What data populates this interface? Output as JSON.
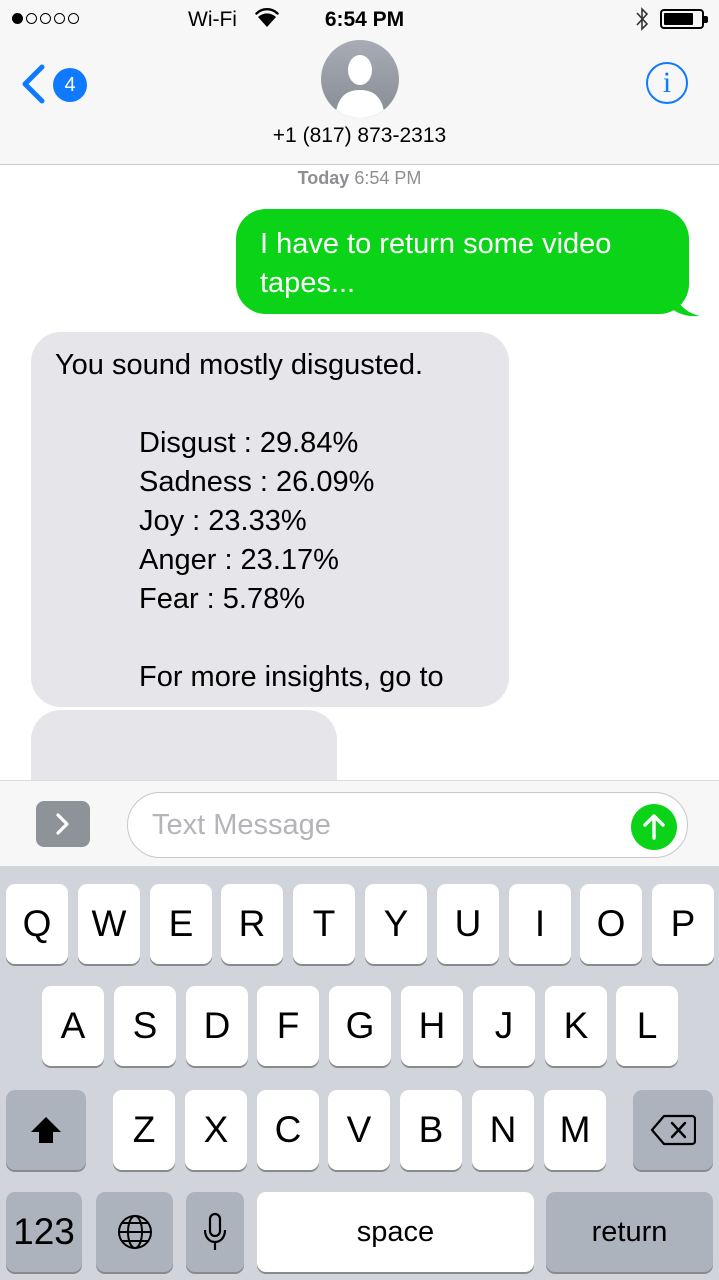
{
  "status_bar": {
    "carrier_signal": "●○○○○",
    "network": "Wi-Fi",
    "time": "6:54 PM",
    "wifi_icon": "wifi-icon",
    "bluetooth_icon": "bluetooth-icon",
    "battery_level": 0.8
  },
  "header": {
    "back_badge": "4",
    "contact": "+1 (817) 873-2313",
    "info_label": "i",
    "back_icon": "chevron-left-icon",
    "avatar_icon": "person-silhouette-icon"
  },
  "thread": {
    "timestamp_day": "Today",
    "timestamp_time": "6:54 PM",
    "messages": [
      {
        "direction": "sent",
        "text": "I have to return some video tapes..."
      },
      {
        "direction": "received",
        "intro": "You sound mostly disgusted.",
        "scores": [
          {
            "label": "Disgust : 29.84%"
          },
          {
            "label": "Sadness : 26.09%"
          },
          {
            "label": "Joy : 23.33%"
          },
          {
            "label": "Anger : 23.17%"
          },
          {
            "label": "Fear : 5.78%"
          }
        ],
        "footer": "For more insights, go to"
      }
    ]
  },
  "input": {
    "placeholder": "Text Message",
    "apps_icon": "chevron-right-icon",
    "send_icon": "arrow-up-icon"
  },
  "keyboard": {
    "row1": [
      "Q",
      "W",
      "E",
      "R",
      "T",
      "Y",
      "U",
      "I",
      "O",
      "P"
    ],
    "row2": [
      "A",
      "S",
      "D",
      "F",
      "G",
      "H",
      "J",
      "K",
      "L"
    ],
    "row3": [
      "Z",
      "X",
      "C",
      "V",
      "B",
      "N",
      "M"
    ],
    "numbers": "123",
    "space": "space",
    "return": "return",
    "shift_icon": "shift-arrow-icon",
    "delete_icon": "backspace-icon",
    "globe_icon": "globe-icon",
    "mic_icon": "microphone-icon"
  },
  "colors": {
    "ios_blue": "#0f7aff",
    "sent_bubble": "#0bd318",
    "received_bubble": "#e5e5ea",
    "keyboard_bg": "#d1d5db"
  }
}
